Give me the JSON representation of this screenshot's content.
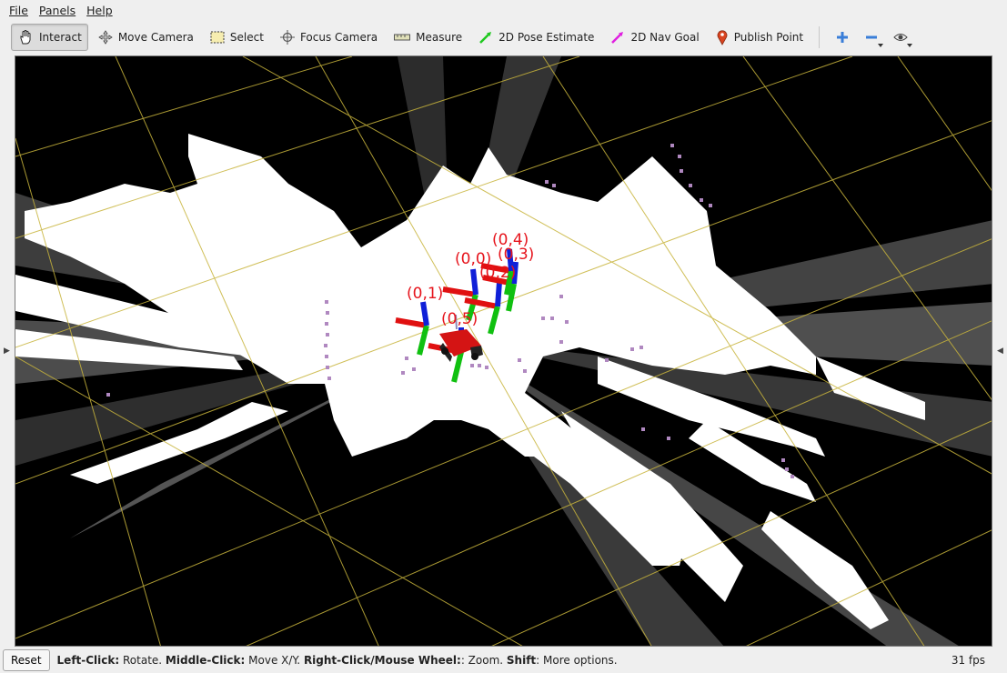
{
  "menubar": {
    "items": [
      {
        "label": "File"
      },
      {
        "label": "Panels"
      },
      {
        "label": "Help"
      }
    ]
  },
  "toolbar": {
    "tools": [
      {
        "label": "Interact",
        "icon": "hand-icon",
        "active": true
      },
      {
        "label": "Move Camera",
        "icon": "move-camera-icon"
      },
      {
        "label": "Select",
        "icon": "select-icon"
      },
      {
        "label": "Focus Camera",
        "icon": "focus-camera-icon"
      },
      {
        "label": "Measure",
        "icon": "ruler-icon"
      },
      {
        "label": "2D Pose Estimate",
        "icon": "green-arrow-icon"
      },
      {
        "label": "2D Nav Goal",
        "icon": "magenta-arrow-icon"
      },
      {
        "label": "Publish Point",
        "icon": "map-pin-icon"
      }
    ],
    "extra_buttons": [
      "add-tool-icon",
      "remove-tool-icon",
      "eye-icon"
    ]
  },
  "viewport": {
    "frame_labels": [
      "(0,4)",
      "(0,0)",
      "(0,3)",
      "(0,2)",
      "(0,1)",
      "(0,5)"
    ],
    "grid_color": "#c8b43c",
    "free_space_color": "#ffffff",
    "label_color": "#e6141c"
  },
  "statusbar": {
    "reset_label": "Reset",
    "hint_parts": [
      {
        "bold": "Left-Click:",
        "text": " Rotate. "
      },
      {
        "bold": "Middle-Click:",
        "text": " Move X/Y. "
      },
      {
        "bold": "Right-Click/Mouse Wheel:",
        "text": ": Zoom. "
      },
      {
        "bold": "Shift",
        "text": ": More options."
      }
    ],
    "fps": "31 fps"
  }
}
